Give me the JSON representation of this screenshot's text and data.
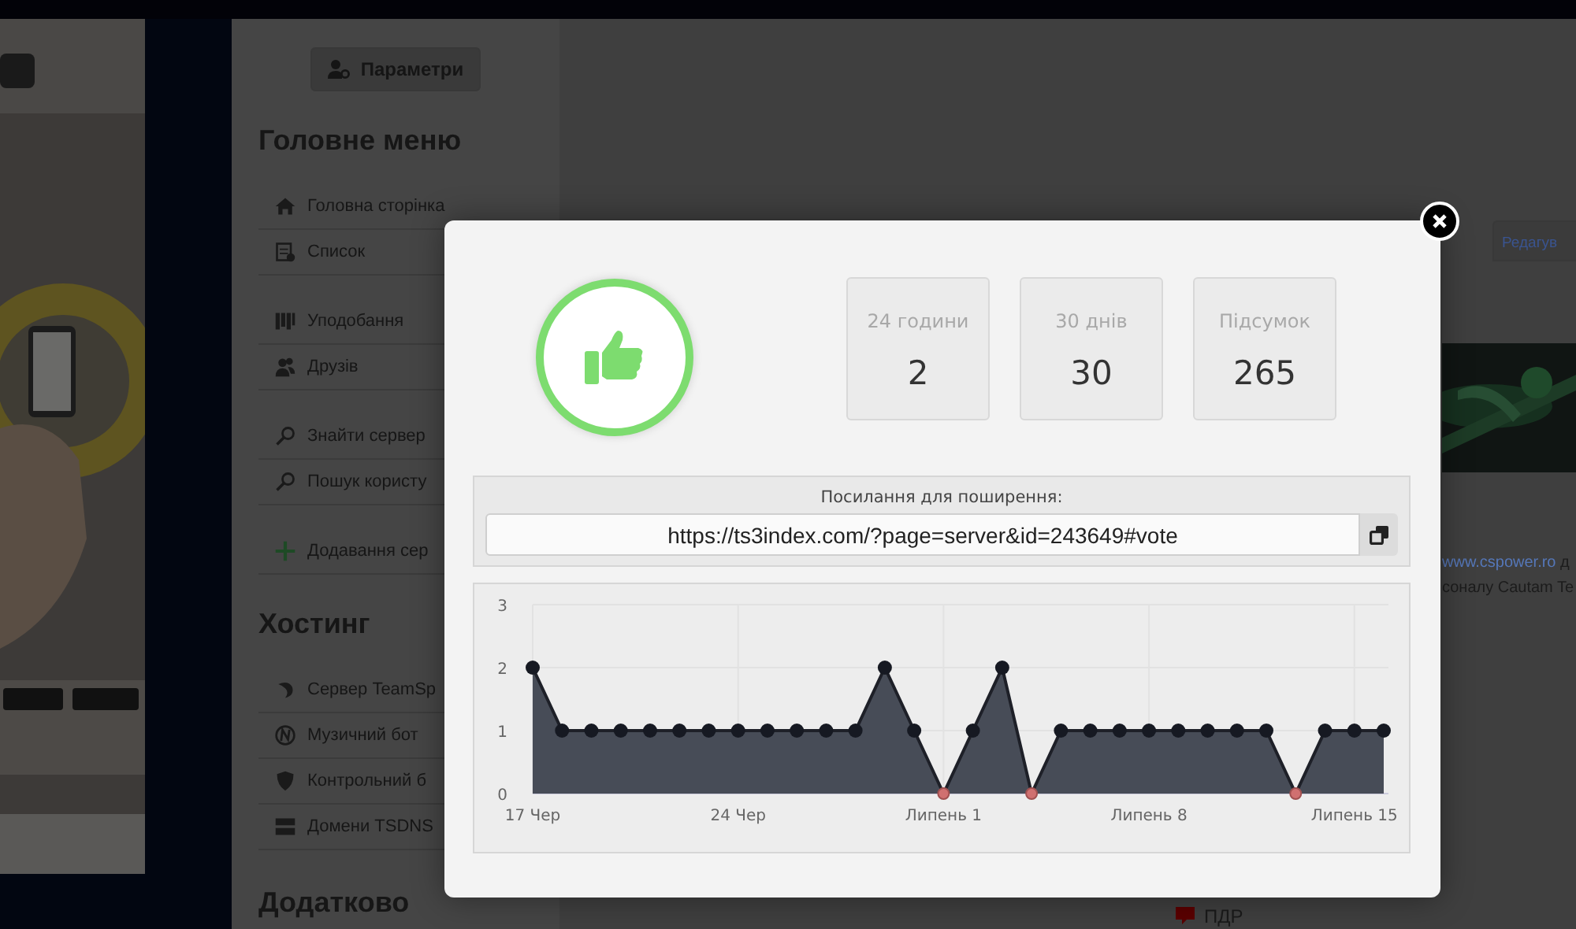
{
  "sidebar": {
    "settings_button": "Параметри",
    "sections": [
      {
        "title": "Головне меню",
        "groups": [
          [
            "Головна сторінка",
            "Список"
          ],
          [
            "Уподобання",
            "Друзів"
          ],
          [
            "Знайти сервер",
            "Пошук користу"
          ],
          [
            "Додавання сер"
          ]
        ]
      },
      {
        "title": "Хостинг",
        "groups": [
          [
            "Сервер TeamSp",
            "Музичний бот",
            "Контрольний б",
            "Домени TSDNS"
          ]
        ]
      },
      {
        "title": "Додатково"
      }
    ]
  },
  "background": {
    "tab": "Редагув",
    "link": "www.cspower.ro",
    "link_after": "д",
    "line_2": "соналу Cautam Te",
    "list_item": "ПДР"
  },
  "modal": {
    "stats": [
      {
        "label": "24 години",
        "value": "2"
      },
      {
        "label": "30 днів",
        "value": "30"
      },
      {
        "label": "Підсумок",
        "value": "265"
      }
    ],
    "share": {
      "label": "Посилання для поширення:",
      "url": "https://ts3index.com/?page=server&id=243649#vote"
    },
    "chart_data": {
      "type": "area",
      "categories": [
        "17 Чер",
        null,
        null,
        null,
        null,
        null,
        null,
        "24 Чер",
        null,
        null,
        null,
        null,
        null,
        null,
        "Липень 1",
        null,
        null,
        null,
        null,
        null,
        null,
        "Липень 8",
        null,
        null,
        null,
        null,
        null,
        null,
        "Липень 15",
        null
      ],
      "series": [
        {
          "color": "#474c57",
          "values": [
            2,
            1,
            1,
            1,
            1,
            1,
            1,
            1,
            1,
            1,
            1,
            1,
            2,
            1,
            0,
            1,
            2,
            0,
            1,
            1,
            1,
            1,
            1,
            1,
            1,
            1,
            0,
            1,
            1,
            1
          ]
        }
      ],
      "ylim": [
        0,
        3
      ],
      "yticks": [
        0,
        1,
        2,
        3
      ],
      "grid": true
    }
  }
}
